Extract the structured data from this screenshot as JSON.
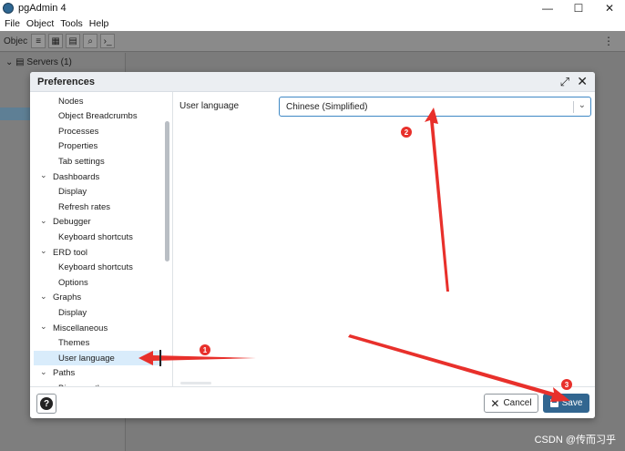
{
  "window": {
    "title": "pgAdmin 4",
    "controls": {
      "minimize": "—",
      "maximize": "☐",
      "close": "✕"
    }
  },
  "menubar": [
    "File",
    "Object",
    "Tools",
    "Help"
  ],
  "background": {
    "toolbar_label": "Objec",
    "tree": {
      "servers_label": "Servers (1)"
    }
  },
  "dialog": {
    "title": "Preferences",
    "nav_items": [
      {
        "label": "Nodes",
        "level": "child"
      },
      {
        "label": "Object Breadcrumbs",
        "level": "child"
      },
      {
        "label": "Processes",
        "level": "child"
      },
      {
        "label": "Properties",
        "level": "child"
      },
      {
        "label": "Tab settings",
        "level": "child"
      },
      {
        "label": "Dashboards",
        "level": "parent"
      },
      {
        "label": "Display",
        "level": "child"
      },
      {
        "label": "Refresh rates",
        "level": "child"
      },
      {
        "label": "Debugger",
        "level": "parent"
      },
      {
        "label": "Keyboard shortcuts",
        "level": "child"
      },
      {
        "label": "ERD tool",
        "level": "parent"
      },
      {
        "label": "Keyboard shortcuts",
        "level": "child"
      },
      {
        "label": "Options",
        "level": "child"
      },
      {
        "label": "Graphs",
        "level": "parent"
      },
      {
        "label": "Display",
        "level": "child"
      },
      {
        "label": "Miscellaneous",
        "level": "parent"
      },
      {
        "label": "Themes",
        "level": "child"
      },
      {
        "label": "User language",
        "level": "child",
        "selected": true
      },
      {
        "label": "Paths",
        "level": "parent"
      },
      {
        "label": "Binary paths",
        "level": "child"
      }
    ],
    "field": {
      "label": "User language",
      "value": "Chinese (Simplified)"
    },
    "footer": {
      "cancel_label": "Cancel",
      "save_label": "Save"
    }
  },
  "annotations": [
    {
      "number": "1"
    },
    {
      "number": "2"
    },
    {
      "number": "3"
    }
  ],
  "watermark": "CSDN @传而习乎",
  "colors": {
    "primary": "#326690",
    "selection": "#d9ecfb",
    "annotation": "#e8302b"
  }
}
